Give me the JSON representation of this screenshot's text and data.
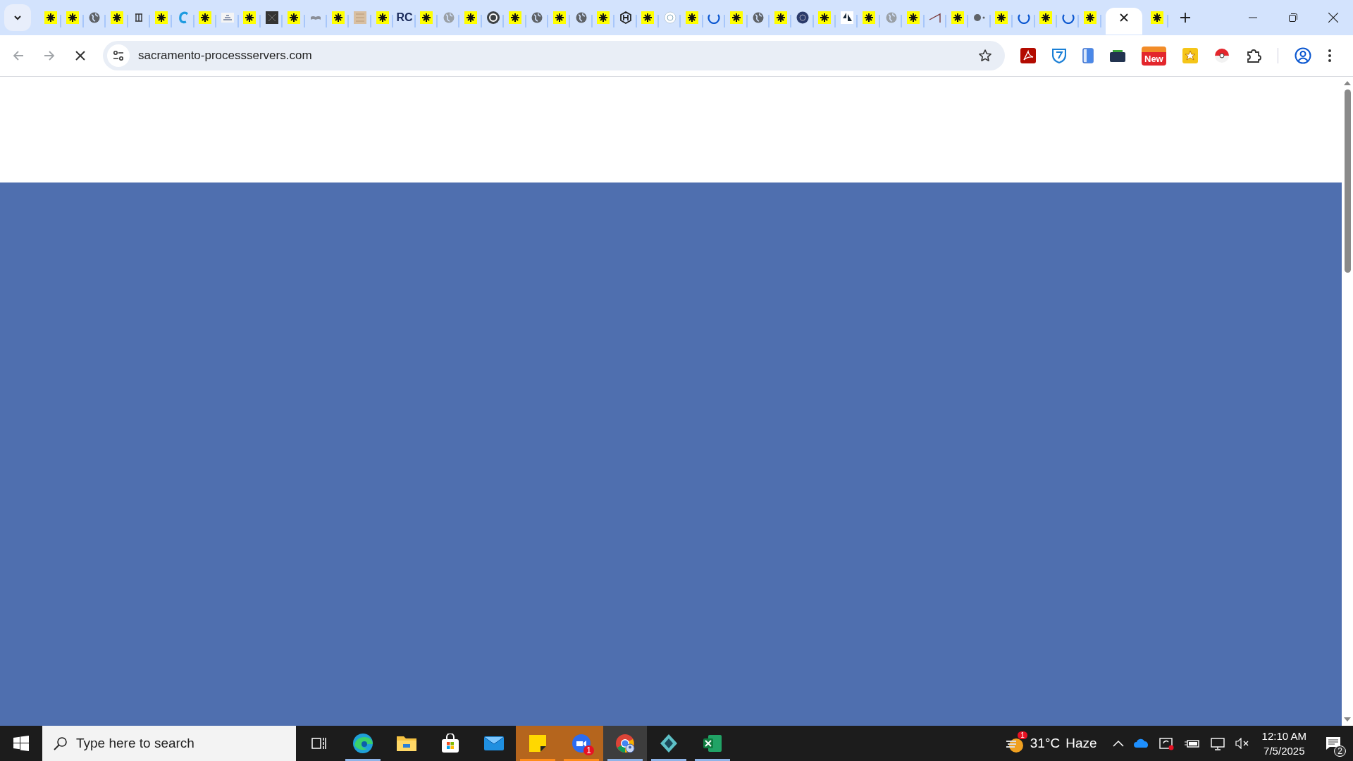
{
  "tabs": [
    {
      "kind": "asterisk",
      "selected": false
    },
    {
      "kind": "asterisk",
      "selected": false
    },
    {
      "kind": "globe",
      "selected": false
    },
    {
      "kind": "asterisk",
      "selected": false
    },
    {
      "kind": "building",
      "selected": false
    },
    {
      "kind": "asterisk",
      "selected": false
    },
    {
      "kind": "c-logo",
      "selected": false
    },
    {
      "kind": "asterisk",
      "selected": false
    },
    {
      "kind": "image",
      "selected": false
    },
    {
      "kind": "asterisk",
      "selected": false
    },
    {
      "kind": "dark-square",
      "selected": false
    },
    {
      "kind": "asterisk",
      "selected": false
    },
    {
      "kind": "book",
      "selected": false
    },
    {
      "kind": "asterisk",
      "selected": false
    },
    {
      "kind": "beige",
      "selected": false
    },
    {
      "kind": "asterisk",
      "selected": false
    },
    {
      "kind": "text",
      "label": "RC",
      "selected": false
    },
    {
      "kind": "asterisk",
      "selected": false
    },
    {
      "kind": "grey-globe",
      "selected": false
    },
    {
      "kind": "asterisk",
      "selected": false
    },
    {
      "kind": "cs-logo",
      "selected": false
    },
    {
      "kind": "asterisk",
      "selected": false
    },
    {
      "kind": "globe",
      "selected": false
    },
    {
      "kind": "asterisk",
      "selected": false
    },
    {
      "kind": "globe",
      "selected": false
    },
    {
      "kind": "asterisk",
      "selected": false
    },
    {
      "kind": "hex-logo",
      "selected": false
    },
    {
      "kind": "asterisk",
      "selected": false
    },
    {
      "kind": "ring-light",
      "selected": false
    },
    {
      "kind": "asterisk",
      "selected": false
    },
    {
      "kind": "spinner",
      "selected": false
    },
    {
      "kind": "asterisk",
      "selected": false
    },
    {
      "kind": "globe",
      "selected": false
    },
    {
      "kind": "asterisk",
      "selected": false
    },
    {
      "kind": "dark-circle",
      "selected": false
    },
    {
      "kind": "asterisk",
      "selected": false
    },
    {
      "kind": "l-logo",
      "selected": false
    },
    {
      "kind": "asterisk",
      "selected": false
    },
    {
      "kind": "grey-globe",
      "selected": false
    },
    {
      "kind": "asterisk",
      "selected": false
    },
    {
      "kind": "slash",
      "selected": false
    },
    {
      "kind": "asterisk",
      "selected": false
    },
    {
      "kind": "dot-globe",
      "selected": false
    },
    {
      "kind": "asterisk",
      "selected": false
    },
    {
      "kind": "blue-ring",
      "selected": false
    },
    {
      "kind": "asterisk",
      "selected": false
    },
    {
      "kind": "spinner",
      "selected": false
    },
    {
      "kind": "asterisk",
      "selected": false
    },
    {
      "kind": "none",
      "selected": true
    },
    {
      "kind": "asterisk",
      "selected": false
    }
  ],
  "address": {
    "url": "sacramento-processservers.com"
  },
  "extensions": [
    {
      "kind": "pdf"
    },
    {
      "kind": "shield"
    },
    {
      "kind": "phone"
    },
    {
      "kind": "folder"
    },
    {
      "kind": "badge",
      "label": "New"
    },
    {
      "kind": "star-tile"
    },
    {
      "kind": "ball"
    },
    {
      "kind": "puzzle"
    }
  ],
  "taskbar": {
    "search": {
      "placeholder": "Type here to search"
    },
    "apps": [
      {
        "kind": "taskview",
        "running": false,
        "highlighted": false,
        "active": false
      },
      {
        "kind": "edge",
        "running": true,
        "highlighted": false,
        "active": false
      },
      {
        "kind": "folder",
        "running": false,
        "highlighted": false,
        "active": false
      },
      {
        "kind": "store",
        "running": false,
        "highlighted": false,
        "active": false
      },
      {
        "kind": "mail",
        "running": false,
        "highlighted": false,
        "active": false
      },
      {
        "kind": "note",
        "running": true,
        "highlighted": true,
        "active": false
      },
      {
        "kind": "zoom",
        "badge": "1",
        "running": true,
        "highlighted": true,
        "active": false
      },
      {
        "kind": "chrome",
        "running": true,
        "highlighted": false,
        "active": true
      },
      {
        "kind": "diamond",
        "running": true,
        "highlighted": false,
        "active": false
      },
      {
        "kind": "excel",
        "running": true,
        "highlighted": false,
        "active": false
      }
    ],
    "weather": {
      "badge": "1",
      "temperature": "31°C",
      "condition": "Haze"
    },
    "clock": {
      "time": "12:10 AM",
      "date": "7/5/2025"
    },
    "notifications": {
      "count": "2"
    }
  }
}
